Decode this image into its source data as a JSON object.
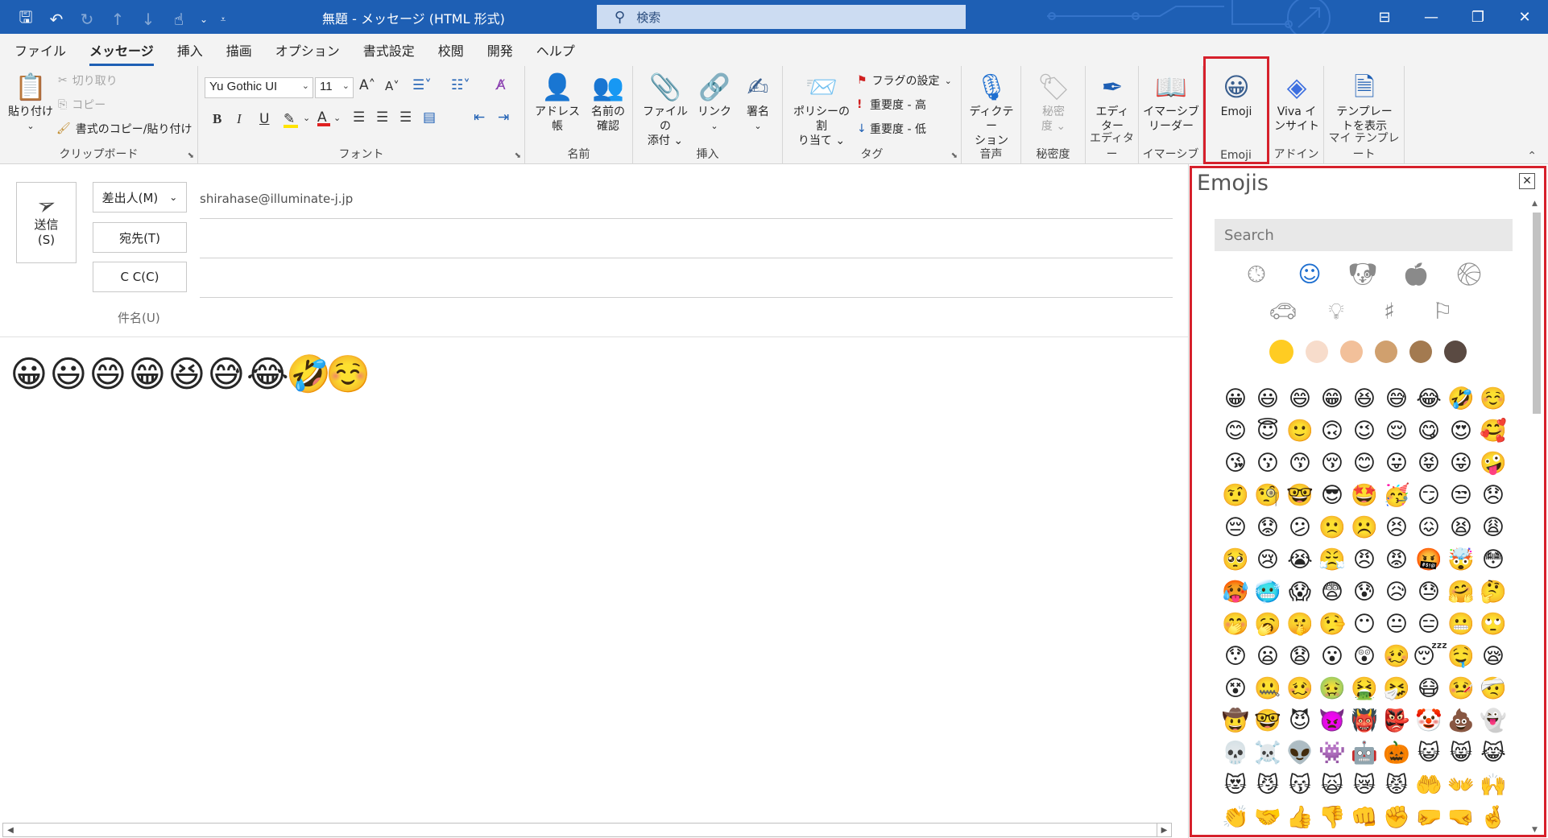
{
  "window": {
    "title": "無題 - メッセージ (HTML 形式)",
    "search_placeholder": "検索"
  },
  "qat": [
    "save-icon",
    "undo-icon",
    "redo-icon",
    "up-icon",
    "down-icon",
    "touch-icon",
    "chevron-down-icon",
    "customize-icon"
  ],
  "menu": {
    "tabs": [
      "ファイル",
      "メッセージ",
      "挿入",
      "描画",
      "オプション",
      "書式設定",
      "校閲",
      "開発",
      "ヘルプ"
    ],
    "active": "メッセージ"
  },
  "ribbon": {
    "clipboard": {
      "label": "クリップボード",
      "paste": "貼り付け",
      "cut": "切り取り",
      "copy": "コピー",
      "format_painter": "書式のコピー/貼り付け"
    },
    "font": {
      "label": "フォント",
      "font_name": "Yu Gothic UI",
      "font_size": "11",
      "bold": "B",
      "italic": "I",
      "underline": "U"
    },
    "names": {
      "label": "名前",
      "address_book": "アドレス帳",
      "check_names_1": "名前の",
      "check_names_2": "確認"
    },
    "include": {
      "label": "挿入",
      "attach_file_1": "ファイルの",
      "attach_file_2": "添付",
      "link": "リンク",
      "signature": "署名"
    },
    "tags": {
      "label": "タグ",
      "policy_1": "ポリシーの割",
      "policy_2": "り当て",
      "follow_up": "フラグの設定",
      "high_importance": "重要度 - 高",
      "low_importance": "重要度 - 低"
    },
    "voice": {
      "label": "音声",
      "dictate_1": "ディクテー",
      "dictate_2": "ション"
    },
    "sensitivity": {
      "label": "秘密度",
      "btn_1": "秘密",
      "btn_2": "度"
    },
    "editor": {
      "label": "エディター",
      "btn_1": "エディ",
      "btn_2": "ター"
    },
    "immersive": {
      "label": "イマーシブ",
      "btn_1": "イマーシブ",
      "btn_2": "リーダー"
    },
    "emoji": {
      "label": "Emoji",
      "btn": "Emoji"
    },
    "addin": {
      "label": "アドイン",
      "btn_1": "Viva イ",
      "btn_2": "ンサイト"
    },
    "templates": {
      "label": "マイ テンプレート",
      "btn_1": "テンプレー",
      "btn_2": "トを表示"
    }
  },
  "compose": {
    "send_1": "送信",
    "send_2": "(S)",
    "from_label": "差出人(M)",
    "from_address": "shirahase@illuminate-j.jp",
    "to_label": "宛先(T)",
    "cc_label": "C C(C)",
    "subject_label": "件名(U)",
    "body_emojis": [
      "😀",
      "😃",
      "😄",
      "😁",
      "😆",
      "😅",
      "😂",
      "🤣",
      "☺️"
    ]
  },
  "emoji_panel": {
    "title": "Emojis",
    "search_placeholder": "Search",
    "categories_row1": [
      "recent-icon",
      "smiley-icon",
      "animal-icon",
      "food-icon",
      "activity-icon"
    ],
    "categories_row2": [
      "travel-icon",
      "objects-icon",
      "symbols-icon",
      "flags-icon"
    ],
    "active_category": "smiley-icon",
    "skin_tones": [
      "#ffcc22",
      "#f7dccb",
      "#f2c09a",
      "#d0a06e",
      "#a37a50",
      "#5a4a42"
    ],
    "emojis": [
      "😀",
      "😃",
      "😄",
      "😁",
      "😆",
      "😅",
      "😂",
      "🤣",
      "☺️",
      "😊",
      "😇",
      "🙂",
      "🙃",
      "😉",
      "😌",
      "😋",
      "😍",
      "🥰",
      "😘",
      "😗",
      "😙",
      "😚",
      "😊",
      "😛",
      "😝",
      "😜",
      "🤪",
      "🤨",
      "🧐",
      "🤓",
      "😎",
      "🤩",
      "🥳",
      "😏",
      "😒",
      "😞",
      "😔",
      "😟",
      "😕",
      "🙁",
      "☹️",
      "😣",
      "😖",
      "😫",
      "😩",
      "🥺",
      "😢",
      "😭",
      "😤",
      "😠",
      "😡",
      "🤬",
      "🤯",
      "😳",
      "🥵",
      "🥶",
      "😱",
      "😨",
      "😰",
      "😥",
      "😓",
      "🤗",
      "🤔",
      "🤭",
      "🥱",
      "🤫",
      "🤥",
      "😶",
      "😐",
      "😑",
      "😬",
      "🙄",
      "😯",
      "😦",
      "😧",
      "😮",
      "😲",
      "🥴",
      "😴",
      "🤤",
      "😪",
      "😵",
      "🤐",
      "🥴",
      "🤢",
      "🤮",
      "🤧",
      "😷",
      "🤒",
      "🤕",
      "🤠",
      "🤓",
      "😈",
      "👿",
      "👹",
      "👺",
      "🤡",
      "💩",
      "👻",
      "💀",
      "☠️",
      "👽",
      "👾",
      "🤖",
      "🎃",
      "😺",
      "😸",
      "😹",
      "😻",
      "😼",
      "😽",
      "🙀",
      "😿",
      "😾",
      "🤲",
      "👐",
      "🙌",
      "👏",
      "🤝",
      "👍",
      "👎",
      "👊",
      "✊",
      "🤛",
      "🤜",
      "🤞"
    ]
  }
}
